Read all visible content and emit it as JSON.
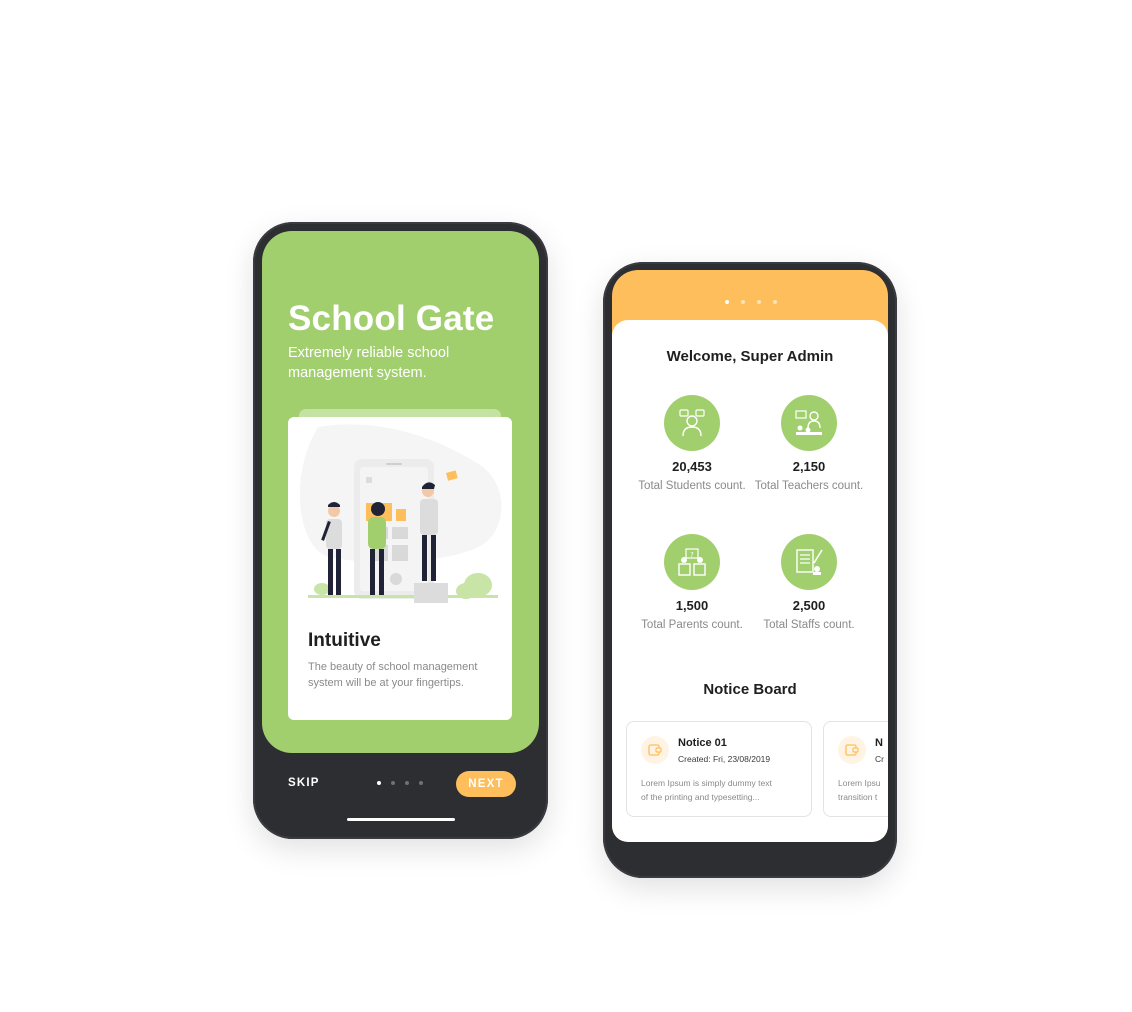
{
  "colors": {
    "green": "#a2cf6e",
    "orange": "#ffbe5c",
    "phone_frame": "#2d2e32",
    "white": "#ffffff"
  },
  "onboarding": {
    "title": "School Gate",
    "subtitle": "Extremely reliable school management system.",
    "card": {
      "illustration": "people-with-phone-illustration",
      "title": "Intuitive",
      "text": "The beauty of school management system will be at your fingertips."
    },
    "skip_label": "SKIP",
    "next_label": "NEXT",
    "page_count": 4,
    "active_page": 1
  },
  "dashboard": {
    "page_count": 4,
    "active_page": 1,
    "welcome": "Welcome, Super Admin",
    "stats": [
      {
        "icon": "student-icon",
        "value": "20,453",
        "label": "Total Students count."
      },
      {
        "icon": "teacher-icon",
        "value": "2,150",
        "label": "Total Teachers count."
      },
      {
        "icon": "parents-icon",
        "value": "1,500",
        "label": "Total Parents count."
      },
      {
        "icon": "staff-icon",
        "value": "2,500",
        "label": "Total Staffs count."
      }
    ],
    "notice_heading": "Notice Board",
    "notices": [
      {
        "icon": "notice-icon",
        "title": "Notice 01",
        "date": "Created: Fri, 23/08/2019",
        "text_line1": "Lorem Ipsum is simply dummy text",
        "text_line2": "of the printing and typesetting..."
      },
      {
        "icon": "notice-icon",
        "title": "N",
        "date": "Cr",
        "text_line1": "Lorem Ipsu",
        "text_line2": "transition t"
      }
    ]
  }
}
